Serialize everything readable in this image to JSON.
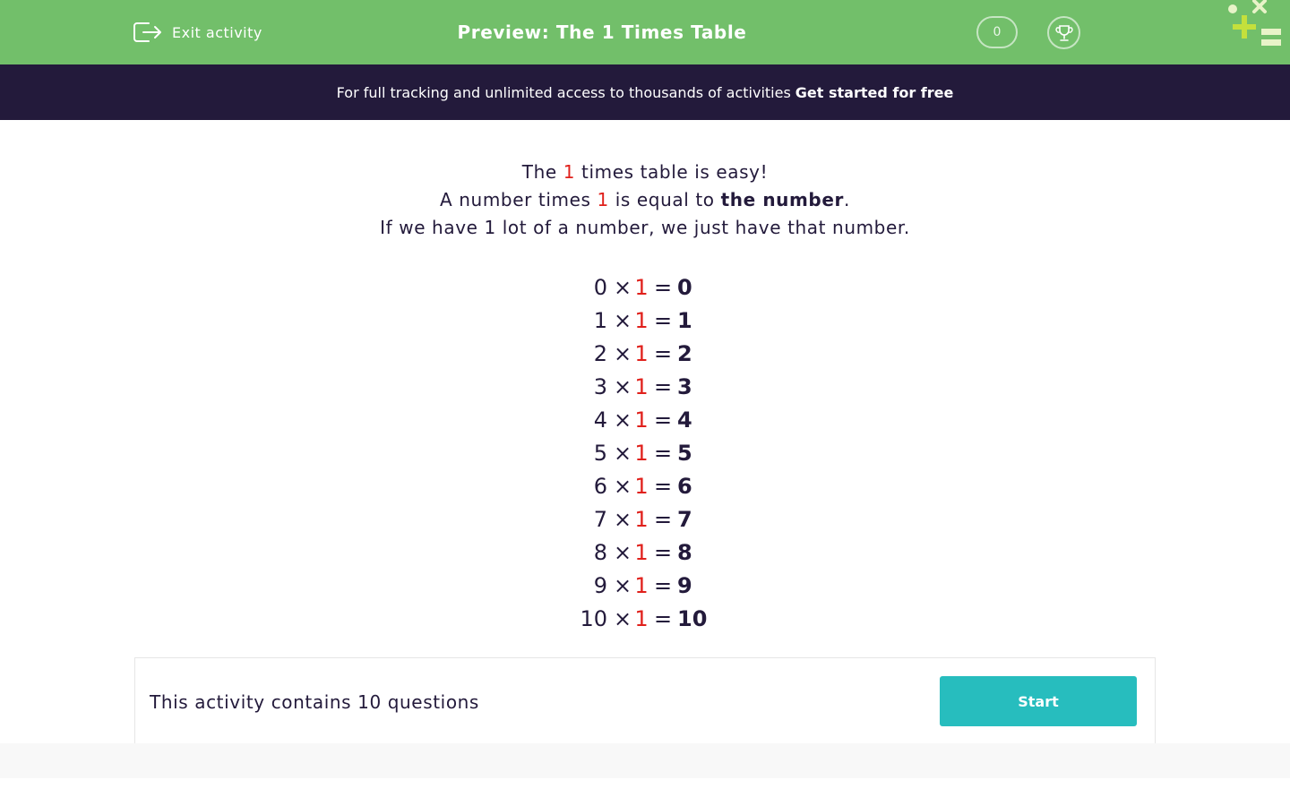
{
  "header": {
    "exit_label": "Exit activity",
    "title": "Preview: The 1 Times Table",
    "score": "0",
    "bg_color": "#72bf6a"
  },
  "banner": {
    "text": "For full tracking and unlimited access to thousands of activities",
    "cta": "Get started for free"
  },
  "intro": {
    "line1": {
      "pre": "The",
      "highlight": "1",
      "post": "times table is easy!"
    },
    "line2": {
      "pre": "A number times",
      "highlight": "1",
      "mid": "is equal to",
      "bold": "the number",
      "post": "."
    },
    "line3": "If we have 1 lot of a number, we just have that number."
  },
  "table": {
    "operator": "×",
    "multiplier": "1",
    "equals": "=",
    "rows": [
      {
        "a": "0",
        "result": "0"
      },
      {
        "a": "1",
        "result": "1"
      },
      {
        "a": "2",
        "result": "2"
      },
      {
        "a": "3",
        "result": "3"
      },
      {
        "a": "4",
        "result": "4"
      },
      {
        "a": "5",
        "result": "5"
      },
      {
        "a": "6",
        "result": "6"
      },
      {
        "a": "7",
        "result": "7"
      },
      {
        "a": "8",
        "result": "8"
      },
      {
        "a": "9",
        "result": "9"
      },
      {
        "a": "10",
        "result": "10"
      }
    ]
  },
  "panel": {
    "text": "This activity contains 10 questions",
    "start_label": "Start"
  },
  "colors": {
    "accent_green": "#72bf6a",
    "dark_navy": "#231a3b",
    "highlight_red": "#e0201b",
    "teal_button": "#27bdbe"
  },
  "icons": {
    "exit": "exit-icon",
    "trophy": "trophy-icon",
    "logo": "logo-icon"
  }
}
